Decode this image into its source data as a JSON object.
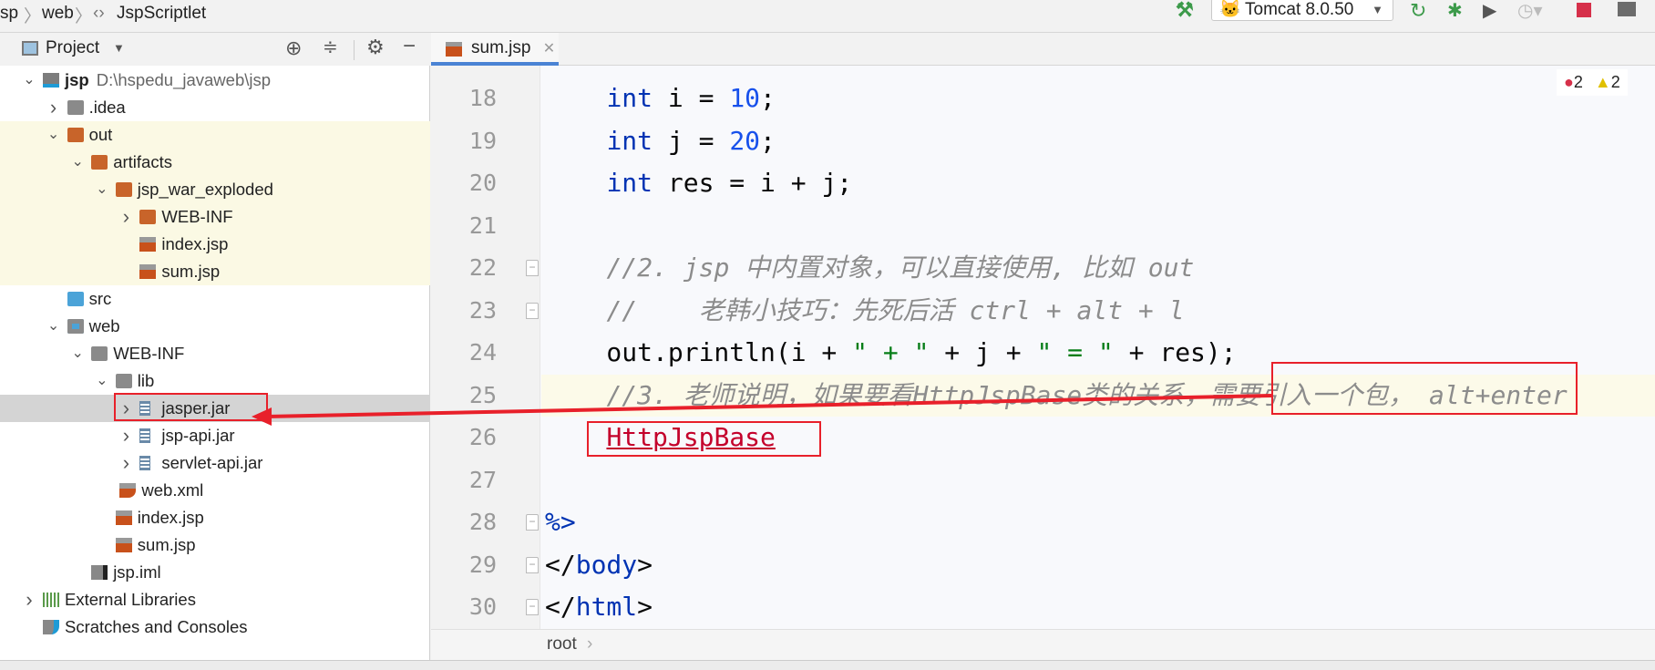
{
  "breadcrumb": [
    "sp",
    "web",
    "JspScriptlet"
  ],
  "toolbar": {
    "run_config": "Tomcat 8.0.50",
    "icons": [
      "hammer-icon",
      "tomcat-icon",
      "rerun-icon",
      "debug-icon",
      "coverage-icon",
      "profile-icon",
      "stop-icon",
      "project-structure-icon"
    ],
    "stop_color": "#d6304a",
    "run_color": "#3c9a4a"
  },
  "project_panel": {
    "title": "Project",
    "icons": [
      "locate-icon",
      "collapse-icon",
      "gear-icon",
      "minimize-icon"
    ]
  },
  "tree": [
    {
      "label": "jsp",
      "path": "D:\\hspedu_javaweb\\jsp",
      "level": 0,
      "chevron": "down",
      "icon": "module",
      "bold": true
    },
    {
      "label": ".idea",
      "level": 1,
      "chevron": "right",
      "icon": "folder-gray"
    },
    {
      "label": "out",
      "level": 1,
      "chevron": "down",
      "icon": "folder-orange",
      "highlight": true
    },
    {
      "label": "artifacts",
      "level": 2,
      "chevron": "down",
      "icon": "folder-orange",
      "highlight": true
    },
    {
      "label": "jsp_war_exploded",
      "level": 3,
      "chevron": "down",
      "icon": "folder-orange",
      "highlight": true
    },
    {
      "label": "WEB-INF",
      "level": 4,
      "chevron": "right",
      "icon": "folder-orange",
      "highlight": true
    },
    {
      "label": "index.jsp",
      "level": 4,
      "icon": "jsp",
      "highlight": true
    },
    {
      "label": "sum.jsp",
      "level": 4,
      "icon": "jsp",
      "highlight": true
    },
    {
      "label": "src",
      "level": 1,
      "icon": "folder-blue"
    },
    {
      "label": "web",
      "level": 1,
      "chevron": "down",
      "icon": "folder-web"
    },
    {
      "label": "WEB-INF",
      "level": 2,
      "chevron": "down",
      "icon": "folder-gray"
    },
    {
      "label": "lib",
      "level": 3,
      "chevron": "down",
      "icon": "folder-gray"
    },
    {
      "label": "jasper.jar",
      "level": 4,
      "chevron": "right",
      "icon": "jar",
      "selected": true
    },
    {
      "label": "jsp-api.jar",
      "level": 4,
      "chevron": "right",
      "icon": "jar"
    },
    {
      "label": "servlet-api.jar",
      "level": 4,
      "chevron": "right",
      "icon": "jar"
    },
    {
      "label": "web.xml",
      "level": 4,
      "icon": "xml",
      "nochev": true
    },
    {
      "label": "index.jsp",
      "level": 3,
      "icon": "jsp"
    },
    {
      "label": "sum.jsp",
      "level": 3,
      "icon": "jsp"
    },
    {
      "label": "jsp.iml",
      "level": 2,
      "icon": "iml"
    },
    {
      "label": "External Libraries",
      "level": 0,
      "chevron": "right",
      "icon": "libraries"
    },
    {
      "label": "Scratches and Consoles",
      "level": 0,
      "icon": "scratches"
    }
  ],
  "editor": {
    "tab": "sum.jsp",
    "errors": "2",
    "warnings": "2",
    "lines": [
      {
        "n": "18",
        "tokens": [
          [
            "",
            "    "
          ],
          [
            "kw",
            "int"
          ],
          [
            "",
            " i = "
          ],
          [
            "num",
            "10"
          ],
          [
            "",
            ";"
          ]
        ]
      },
      {
        "n": "19",
        "tokens": [
          [
            "",
            "    "
          ],
          [
            "kw",
            "int"
          ],
          [
            "",
            " j = "
          ],
          [
            "num",
            "20"
          ],
          [
            "",
            ";"
          ]
        ]
      },
      {
        "n": "20",
        "tokens": [
          [
            "",
            "    "
          ],
          [
            "kw",
            "int"
          ],
          [
            "",
            " res = i + j;"
          ]
        ]
      },
      {
        "n": "21",
        "tokens": []
      },
      {
        "n": "22",
        "fold": true,
        "tokens": [
          [
            "",
            "    "
          ],
          [
            "cm",
            "//2. jsp 中内置对象，可以直接使用, 比如 out"
          ]
        ]
      },
      {
        "n": "23",
        "fold": true,
        "tokens": [
          [
            "",
            "    "
          ],
          [
            "cm",
            "//    老韩小技巧：先死后活 ctrl + alt + l"
          ]
        ]
      },
      {
        "n": "24",
        "tokens": [
          [
            "",
            "    out.println(i + "
          ],
          [
            "str",
            "\" + \""
          ],
          [
            "",
            " + j + "
          ],
          [
            "str",
            "\" = \""
          ],
          [
            "",
            " + res);"
          ]
        ]
      },
      {
        "n": "25",
        "current": true,
        "tokens": [
          [
            "",
            "    "
          ],
          [
            "cm",
            "//3. 老师说明，如果要看HttpJspBase类的关系，需要引入一个包， alt+enter"
          ]
        ]
      },
      {
        "n": "26",
        "tokens": [
          [
            "",
            "    "
          ],
          [
            "err",
            "HttpJspBase"
          ]
        ]
      },
      {
        "n": "27",
        "tokens": []
      },
      {
        "n": "28",
        "fold": true,
        "tokens": [
          [
            "tag",
            "%>"
          ]
        ]
      },
      {
        "n": "29",
        "fold": true,
        "tokens": [
          [
            "",
            "</"
          ],
          [
            "tag",
            "body"
          ],
          [
            "",
            ">"
          ]
        ]
      },
      {
        "n": "30",
        "fold": true,
        "tokens": [
          [
            "",
            "</"
          ],
          [
            "tag",
            "html"
          ],
          [
            "",
            ">"
          ]
        ]
      }
    ],
    "breadcrumb": "root"
  },
  "annotation_color": "#e8202a"
}
